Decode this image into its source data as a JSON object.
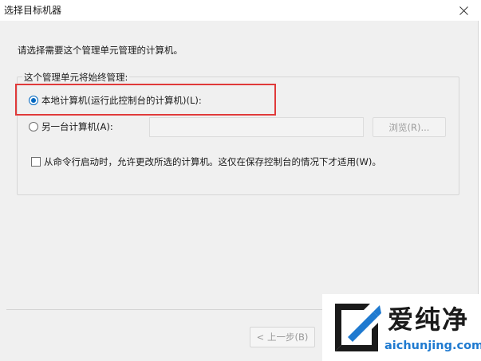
{
  "window": {
    "title": "选择目标机器",
    "close_icon": "close-icon"
  },
  "instruction": "请选择需要这个管理单元管理的计算机。",
  "group": {
    "legend": "这个管理单元将始终管理:",
    "options": [
      {
        "label": "本地计算机(运行此控制台的计算机)(L):",
        "checked": true
      },
      {
        "label": "另一台计算机(A):",
        "checked": false
      }
    ],
    "computer_input": {
      "value": ""
    },
    "browse_label": "浏览(R)...",
    "checkbox": {
      "label": "从命令行启动时，允许更改所选的计算机。这仅在保存控制台的情况下才适用(W)。",
      "checked": false
    }
  },
  "footer": {
    "back_label": "< 上一步(B)"
  },
  "watermark": {
    "brand": "爱纯净",
    "domain": "aichunjing.com"
  },
  "colors": {
    "accent": "#0067c0",
    "highlight": "#e03a3a",
    "watermark_domain": "#1f7ad0"
  }
}
